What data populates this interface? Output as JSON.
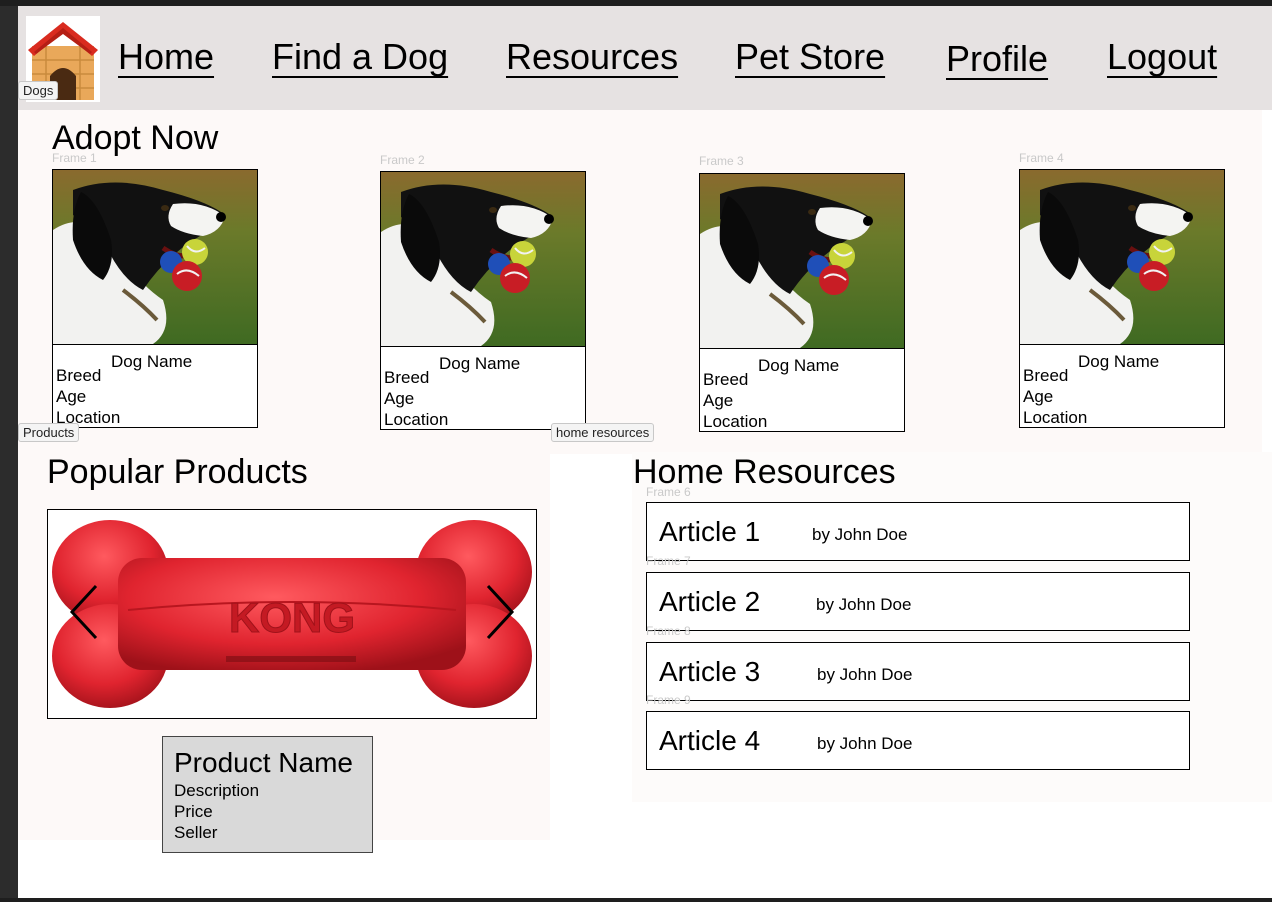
{
  "nav": {
    "logo_tag": "Dogs",
    "links": [
      "Home",
      "Find a Dog",
      "Resources",
      "Pet Store",
      "Profile",
      "Logout"
    ]
  },
  "adopt": {
    "title": "Adopt Now",
    "cards": [
      {
        "frame": "Frame 1",
        "name": "Dog Name",
        "breed": "Breed",
        "age": "Age",
        "location": "Location"
      },
      {
        "frame": "Frame 2",
        "name": "Dog Name",
        "breed": "Breed",
        "age": "Age",
        "location": "Location"
      },
      {
        "frame": "Frame 3",
        "name": "Dog Name",
        "breed": "Breed",
        "age": "Age",
        "location": "Location"
      },
      {
        "frame": "Frame 4",
        "name": "Dog Name",
        "breed": "Breed",
        "age": "Age",
        "location": "Location"
      }
    ]
  },
  "tags": {
    "products": "Products",
    "home_resources": "home resources"
  },
  "products": {
    "title": "Popular Products",
    "toy_brand": "KONG",
    "card": {
      "name": "Product Name",
      "description": "Description",
      "price": "Price",
      "seller": "Seller"
    }
  },
  "resources": {
    "title": "Home Resources",
    "articles": [
      {
        "frame": "Frame 6",
        "title": "Article 1",
        "author": "by John  Doe"
      },
      {
        "frame": "Frame 7",
        "title": "Article 2",
        "author": "by John  Doe"
      },
      {
        "frame": "Frame 8",
        "title": "Article 3",
        "author": "by John  Doe"
      },
      {
        "frame": "Frame 9",
        "title": "Article 4",
        "author": "by John  Doe"
      }
    ]
  },
  "colors": {
    "nav_bg": "#e6e2e2",
    "section_bg": "#fdf9f8",
    "product_card_bg": "#d9d9d9",
    "toy_red": "#e0242f",
    "roof_red": "#d92b1f"
  }
}
